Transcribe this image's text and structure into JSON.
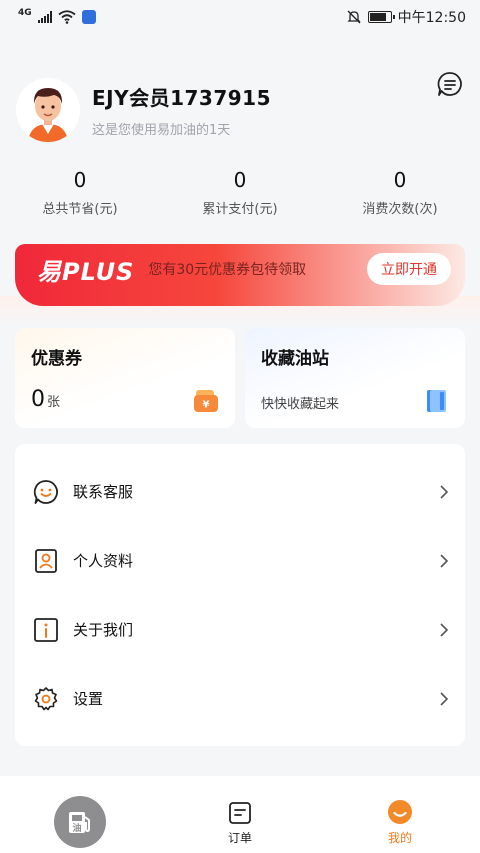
{
  "status_bar": {
    "network": "4G",
    "time": "中午12:50"
  },
  "profile": {
    "username": "EJY会员1737915",
    "subtitle": "这是您使用易加油的1天"
  },
  "stats": [
    {
      "value": "0",
      "label": "总共节省(元)"
    },
    {
      "value": "0",
      "label": "累计支付(元)"
    },
    {
      "value": "0",
      "label": "消费次数(次)"
    }
  ],
  "plus_banner": {
    "logo": "易PLUS",
    "text": "您有30元优惠券包待领取",
    "button": "立即开通"
  },
  "coupon_card": {
    "title": "优惠券",
    "count": "0",
    "unit": "张"
  },
  "favorite_card": {
    "title": "收藏油站",
    "subtitle": "快快收藏起来"
  },
  "menu": [
    {
      "label": "联系客服",
      "icon": "customer-service-icon"
    },
    {
      "label": "个人资料",
      "icon": "profile-card-icon"
    },
    {
      "label": "关于我们",
      "icon": "info-icon"
    },
    {
      "label": "设置",
      "icon": "gear-icon"
    }
  ],
  "bottom_nav": {
    "gas_icon_char": "油",
    "orders": "订单",
    "mine": "我的"
  },
  "colors": {
    "accent": "#f07a1a",
    "banner_red": "#f0283a",
    "background": "#f5f6f8"
  }
}
